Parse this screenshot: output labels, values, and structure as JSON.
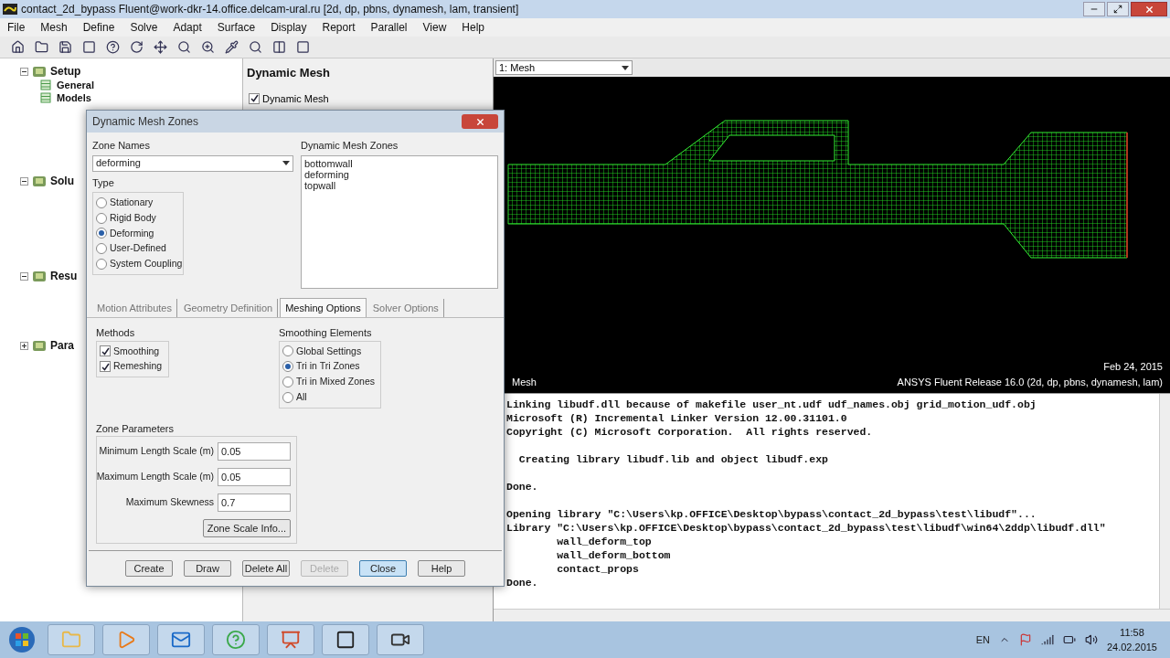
{
  "window": {
    "title": "contact_2d_bypass Fluent@work-dkr-14.office.delcam-ural.ru  [2d, dp, pbns, dynamesh, lam, transient]"
  },
  "menu": [
    "File",
    "Mesh",
    "Define",
    "Solve",
    "Adapt",
    "Surface",
    "Display",
    "Report",
    "Parallel",
    "View",
    "Help"
  ],
  "tree": [
    {
      "label": "Setup",
      "expanded": true,
      "children": [
        {
          "label": "General"
        },
        {
          "label": "Models"
        }
      ]
    },
    {
      "label": "Solu",
      "expanded": true
    },
    {
      "label": "Resu",
      "expanded": true
    },
    {
      "label": "Para",
      "expanded": false
    }
  ],
  "task_page": {
    "title": "Dynamic Mesh",
    "dynamic_mesh_checkbox": {
      "label": "Dynamic Mesh",
      "checked": true
    }
  },
  "dialog": {
    "title": "Dynamic Mesh Zones",
    "zone_names_label": "Zone Names",
    "zone_name": "deforming",
    "type_label": "Type",
    "types": [
      {
        "label": "Stationary",
        "selected": false
      },
      {
        "label": "Rigid Body",
        "selected": false
      },
      {
        "label": "Deforming",
        "selected": true
      },
      {
        "label": "User-Defined",
        "selected": false
      },
      {
        "label": "System Coupling",
        "selected": false
      }
    ],
    "zones_label": "Dynamic Mesh Zones",
    "zones": [
      "bottomwall",
      "deforming",
      "topwall"
    ],
    "tabs": [
      {
        "label": "Motion Attributes",
        "selected": false
      },
      {
        "label": "Geometry Definition",
        "selected": false
      },
      {
        "label": "Meshing Options",
        "selected": true
      },
      {
        "label": "Solver Options",
        "selected": false
      }
    ],
    "methods_label": "Methods",
    "methods": [
      {
        "label": "Smoothing",
        "checked": true
      },
      {
        "label": "Remeshing",
        "checked": true
      }
    ],
    "smoothing_label": "Smoothing Elements",
    "smoothing": [
      {
        "label": "Global Settings",
        "selected": false
      },
      {
        "label": "Tri in Tri Zones",
        "selected": true
      },
      {
        "label": "Tri in Mixed Zones",
        "selected": false
      },
      {
        "label": "All",
        "selected": false
      }
    ],
    "params_label": "Zone Parameters",
    "params": [
      {
        "label": "Minimum Length Scale (m)",
        "value": "0.05"
      },
      {
        "label": "Maximum Length Scale (m)",
        "value": "0.05"
      },
      {
        "label": "Maximum Skewness",
        "value": "0.7"
      }
    ],
    "scale_info_button": "Zone Scale Info...",
    "buttons": [
      {
        "label": "Create",
        "disabled": false,
        "focused": false
      },
      {
        "label": "Draw",
        "disabled": false,
        "focused": false
      },
      {
        "label": "Delete All",
        "disabled": false,
        "focused": false
      },
      {
        "label": "Delete",
        "disabled": true,
        "focused": false
      },
      {
        "label": "Close",
        "disabled": false,
        "focused": true
      },
      {
        "label": "Help",
        "disabled": false,
        "focused": false
      }
    ]
  },
  "graphics": {
    "view": "1: Mesh",
    "label": "Mesh",
    "date": "Feb 24, 2015",
    "release": "ANSYS Fluent Release 16.0 (2d, dp, pbns, dynamesh, lam)"
  },
  "console": {
    "blocks": [
      [
        "Linking libudf.dll because of makefile user_nt.udf udf_names.obj grid_motion_udf.obj",
        "Microsoft (R) Incremental Linker Version 12.00.31101.0",
        "Copyright (C) Microsoft Corporation.  All rights reserved."
      ],
      [
        "  Creating library libudf.lib and object libudf.exp"
      ],
      [
        "Done."
      ],
      [
        "Opening library \"C:\\Users\\kp.OFFICE\\Desktop\\bypass\\contact_2d_bypass\\test\\libudf\"...",
        "Library \"C:\\Users\\kp.OFFICE\\Desktop\\bypass\\contact_2d_bypass\\test\\libudf\\win64\\2ddp\\libudf.dll\"",
        "        wall_deform_top",
        "        wall_deform_bottom",
        "        contact_props",
        "Done."
      ]
    ]
  },
  "taskbar": {
    "language": "EN",
    "time": "11:58",
    "date": "24.02.2015"
  }
}
